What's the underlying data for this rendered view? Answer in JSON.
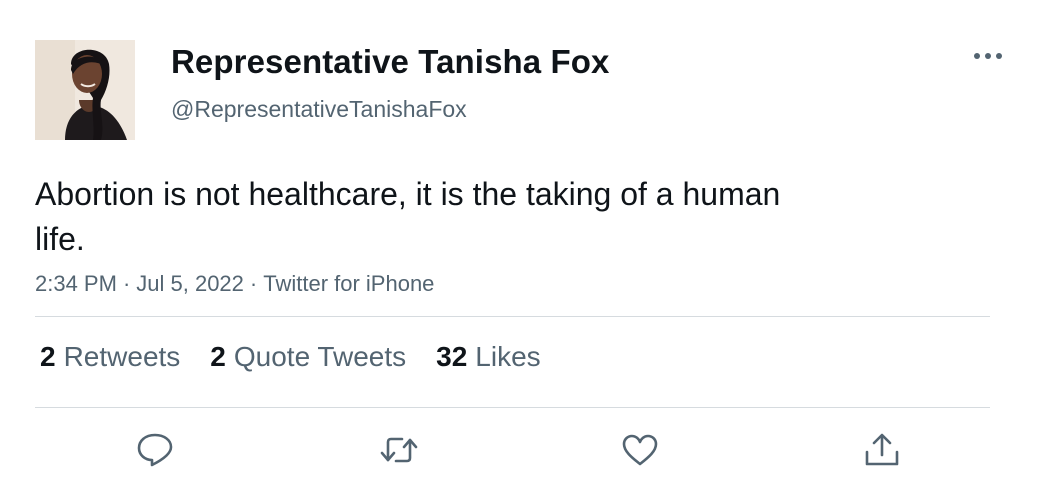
{
  "author": {
    "display_name": "Representative Tanisha Fox",
    "handle": "@RepresentativeTanishaFox",
    "avatar_icon": "profile-photo"
  },
  "tweet": {
    "text": "Abortion is not healthcare, it is the taking of a human life.",
    "time": "2:34 PM",
    "date": "Jul 5, 2022",
    "source": "Twitter for iPhone",
    "separator": "·"
  },
  "stats": {
    "retweets_count": "2",
    "retweets_label": "Retweets",
    "quotes_count": "2",
    "quotes_label": "Quote Tweets",
    "likes_count": "32",
    "likes_label": "Likes"
  },
  "actions": [
    {
      "icon": "reply-icon"
    },
    {
      "icon": "retweet-icon"
    },
    {
      "icon": "like-icon"
    },
    {
      "icon": "share-icon"
    }
  ],
  "colors": {
    "text_primary": "#0f1419",
    "text_secondary": "#536471",
    "divider": "#d6dbdf",
    "icon": "#536471"
  }
}
